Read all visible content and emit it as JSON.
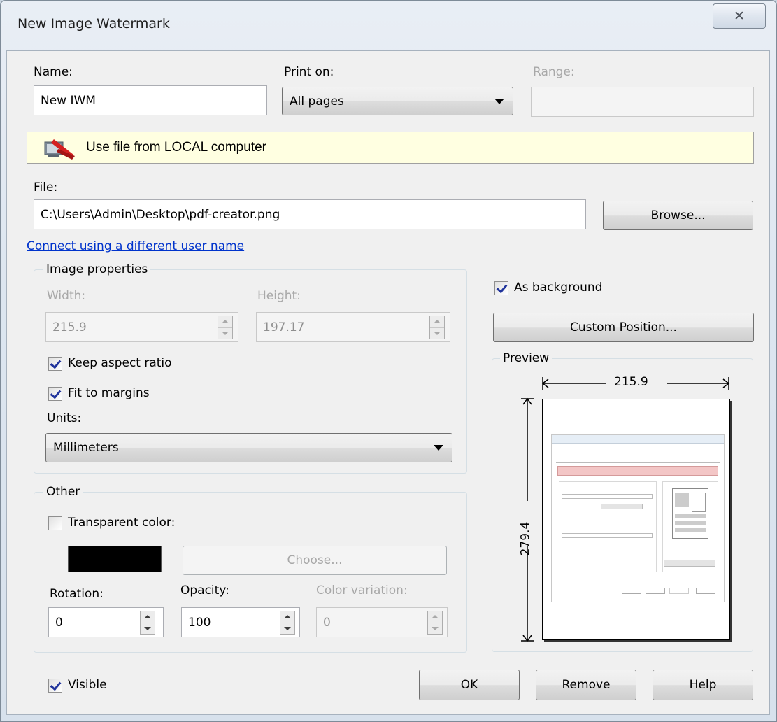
{
  "window": {
    "title": "New Image Watermark",
    "close_glyph": "☒"
  },
  "name": {
    "label": "Name:",
    "value": "New IWM"
  },
  "print_on": {
    "label": "Print on:",
    "value": "All pages"
  },
  "range": {
    "label": "Range:",
    "value": ""
  },
  "banner": {
    "text": "Use file from LOCAL computer",
    "icon": "computer-icon"
  },
  "file": {
    "label": "File:",
    "value": "C:\\Users\\Admin\\Desktop\\pdf-creator.png",
    "browse_label": "Browse..."
  },
  "connect_link": "Connect using a different user name",
  "image_properties": {
    "title": "Image properties",
    "width_label": "Width:",
    "width_value": "215.9",
    "height_label": "Height:",
    "height_value": "197.17",
    "keep_aspect_label": "Keep aspect ratio",
    "keep_aspect_checked": true,
    "fit_margins_label": "Fit to margins",
    "fit_margins_checked": true,
    "units_label": "Units:",
    "units_value": "Millimeters"
  },
  "as_background": {
    "label": "As background",
    "checked": true
  },
  "custom_position_label": "Custom Position...",
  "preview": {
    "title": "Preview",
    "width_value": "215.9",
    "height_value": "279.4"
  },
  "other": {
    "title": "Other",
    "transparent_label": "Transparent color:",
    "transparent_checked": false,
    "swatch_color": "#000000",
    "choose_label": "Choose...",
    "rotation_label": "Rotation:",
    "rotation_value": "0",
    "opacity_label": "Opacity:",
    "opacity_value": "100",
    "color_variation_label": "Color variation:",
    "color_variation_value": "0"
  },
  "visible": {
    "label": "Visible",
    "checked": true
  },
  "buttons": {
    "ok": "OK",
    "remove": "Remove",
    "help": "Help"
  }
}
